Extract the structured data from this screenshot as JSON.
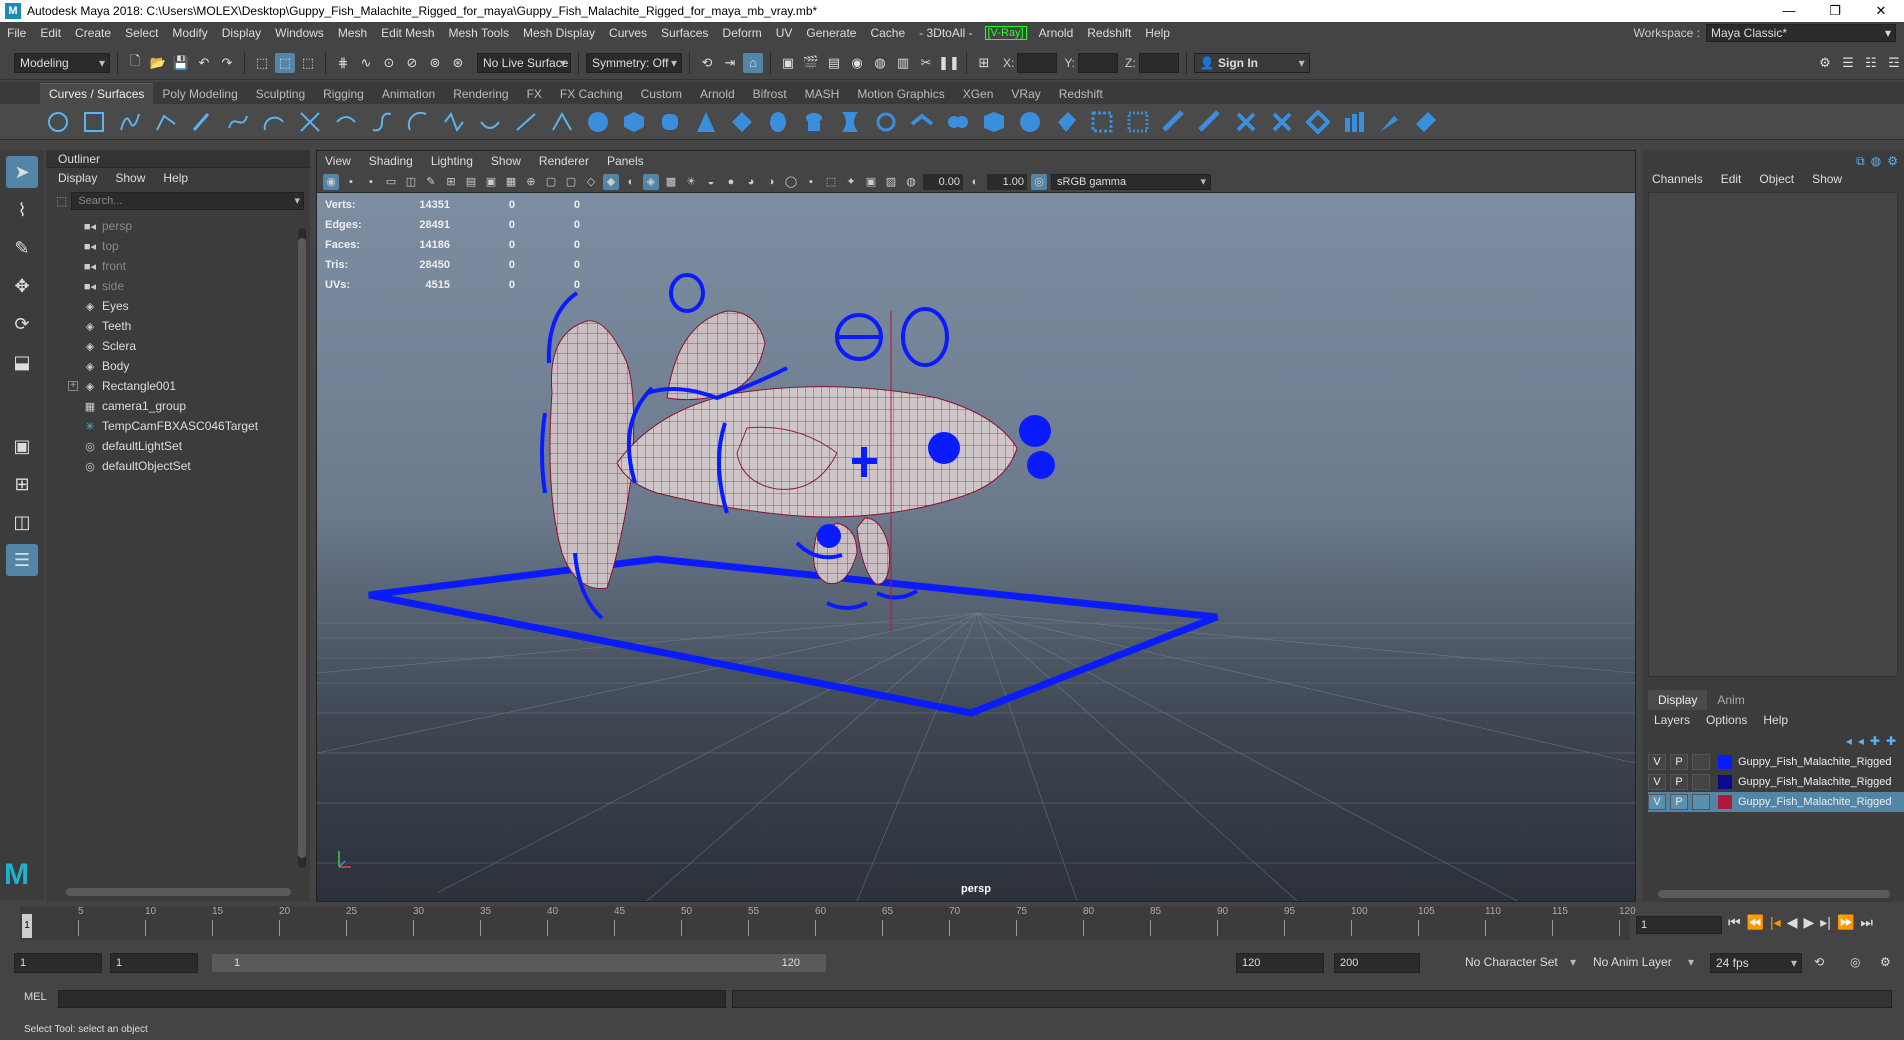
{
  "window": {
    "title": "Autodesk Maya 2018: C:\\Users\\MOLEX\\Desktop\\Guppy_Fish_Malachite_Rigged_for_maya\\Guppy_Fish_Malachite_Rigged_for_maya_mb_vray.mb*",
    "logo": "M"
  },
  "menubar": {
    "items": [
      "File",
      "Edit",
      "Create",
      "Select",
      "Modify",
      "Display",
      "Windows",
      "Mesh",
      "Edit Mesh",
      "Mesh Tools",
      "Mesh Display",
      "Curves",
      "Surfaces",
      "Deform",
      "UV",
      "Generate",
      "Cache",
      "- 3DtoAll -"
    ],
    "vray": "[V-Ray]",
    "items_after": [
      "Arnold",
      "Redshift",
      "Help"
    ],
    "workspace_label": "Workspace :",
    "workspace_value": "Maya Classic*"
  },
  "statusline": {
    "mode": "Modeling",
    "live_surface": "No Live Surface",
    "symmetry": "Symmetry: Off",
    "x_label": "X:",
    "y_label": "Y:",
    "z_label": "Z:",
    "sign_in": "Sign In"
  },
  "shelf": {
    "tabs": [
      "Curves / Surfaces",
      "Poly Modeling",
      "Sculpting",
      "Rigging",
      "Animation",
      "Rendering",
      "FX",
      "FX Caching",
      "Custom",
      "Arnold",
      "Bifrost",
      "MASH",
      "Motion Graphics",
      "XGen",
      "VRay",
      "Redshift"
    ],
    "active_tab": "Curves / Surfaces"
  },
  "outliner": {
    "title": "Outliner",
    "menu": [
      "Display",
      "Show",
      "Help"
    ],
    "search_placeholder": "Search...",
    "items": [
      {
        "label": "persp",
        "icon": "camera-icon",
        "dim": true
      },
      {
        "label": "top",
        "icon": "camera-icon",
        "dim": true
      },
      {
        "label": "front",
        "icon": "camera-icon",
        "dim": true
      },
      {
        "label": "side",
        "icon": "camera-icon",
        "dim": true
      },
      {
        "label": "Eyes",
        "icon": "mesh-icon",
        "dim": false
      },
      {
        "label": "Teeth",
        "icon": "mesh-icon",
        "dim": false
      },
      {
        "label": "Sclera",
        "icon": "mesh-icon",
        "dim": false
      },
      {
        "label": "Body",
        "icon": "mesh-icon",
        "dim": false
      },
      {
        "label": "Rectangle001",
        "icon": "mesh-icon",
        "dim": false,
        "expandable": true
      },
      {
        "label": "camera1_group",
        "icon": "group-icon",
        "dim": false
      },
      {
        "label": "TempCamFBXASC046Target",
        "icon": "locator-icon",
        "dim": false
      },
      {
        "label": "defaultLightSet",
        "icon": "set-icon",
        "dim": false
      },
      {
        "label": "defaultObjectSet",
        "icon": "set-icon",
        "dim": false
      }
    ]
  },
  "viewport": {
    "menu": [
      "View",
      "Shading",
      "Lighting",
      "Show",
      "Renderer",
      "Panels"
    ],
    "exposure": "0.00",
    "gamma": "1.00",
    "color_space": "sRGB gamma",
    "camera": "persp",
    "hud": [
      {
        "label": "Verts:",
        "value": "14351",
        "a": "0",
        "b": "0"
      },
      {
        "label": "Edges:",
        "value": "28491",
        "a": "0",
        "b": "0"
      },
      {
        "label": "Faces:",
        "value": "14186",
        "a": "0",
        "b": "0"
      },
      {
        "label": "Tris:",
        "value": "28450",
        "a": "0",
        "b": "0"
      },
      {
        "label": "UVs:",
        "value": "4515",
        "a": "0",
        "b": "0"
      }
    ],
    "colors": {
      "wire": "#b0183a",
      "controls": "#0a1cff"
    }
  },
  "channelbox": {
    "menu": [
      "Channels",
      "Edit",
      "Object",
      "Show"
    ],
    "layer_tabs": [
      "Display",
      "Anim"
    ],
    "layer_menu": [
      "Layers",
      "Options",
      "Help"
    ],
    "layers": [
      {
        "v": "V",
        "p": "P",
        "color": "#0a1cff",
        "name": "Guppy_Fish_Malachite_Rigged",
        "selected": false
      },
      {
        "v": "V",
        "p": "P",
        "color": "#0a0a8a",
        "name": "Guppy_Fish_Malachite_Rigged",
        "selected": false
      },
      {
        "v": "V",
        "p": "P",
        "color": "#b0183a",
        "name": "Guppy_Fish_Malachite_Rigged",
        "selected": true
      }
    ]
  },
  "timeslider": {
    "ticks": [
      "5",
      "10",
      "15",
      "20",
      "25",
      "30",
      "35",
      "40",
      "45",
      "50",
      "55",
      "60",
      "65",
      "70",
      "75",
      "80",
      "85",
      "90",
      "95",
      "100",
      "105",
      "110",
      "115",
      "120"
    ],
    "current_frame": "1",
    "current_field": "1"
  },
  "rangeslider": {
    "start": "1",
    "playback_start": "1",
    "range_start": "1",
    "range_end": "120",
    "playback_end": "120",
    "end": "200",
    "character_set": "No Character Set",
    "anim_layer": "No Anim Layer",
    "fps": "24 fps"
  },
  "cmdline": {
    "label": "MEL",
    "help": "Select Tool: select an object"
  }
}
